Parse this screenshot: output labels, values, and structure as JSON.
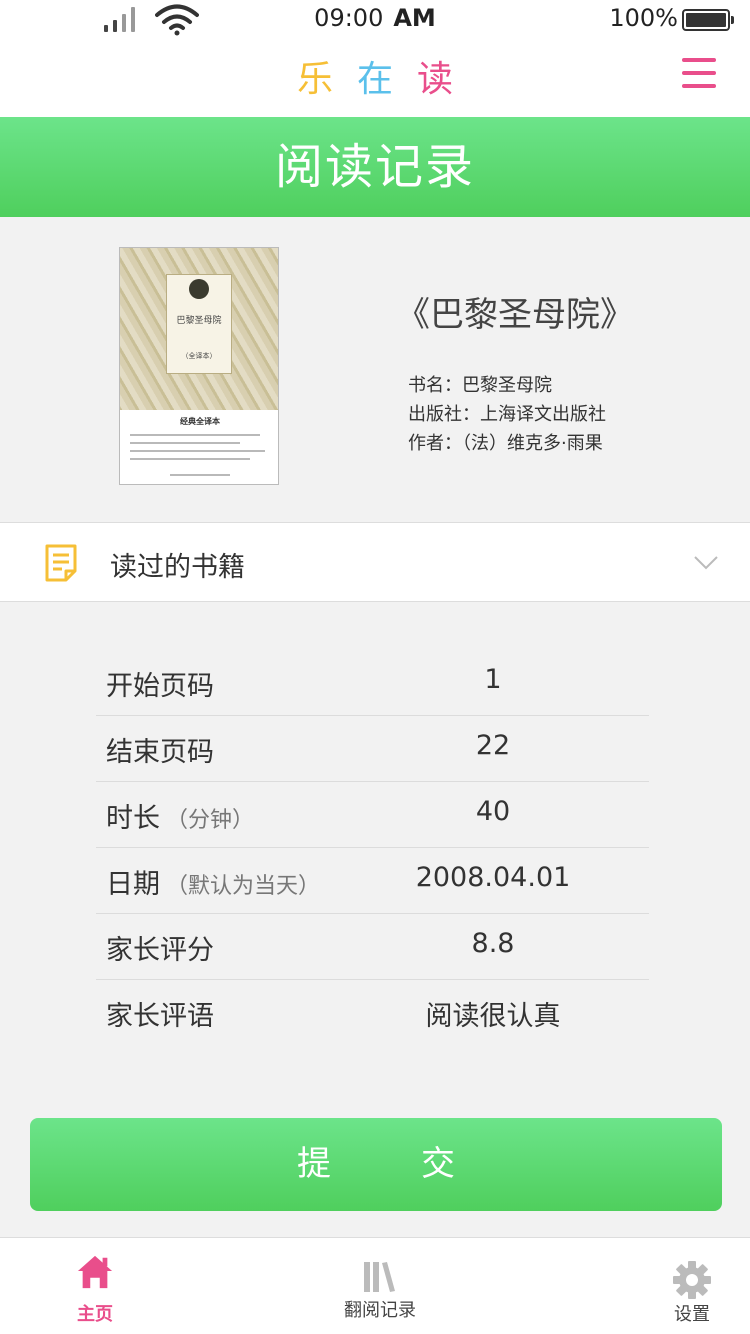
{
  "status_bar": {
    "time": "09:00",
    "ampm": "AM",
    "battery": "100%",
    "battery_level": 1.0
  },
  "header": {
    "logo_chars": [
      "乐",
      "在",
      "读"
    ]
  },
  "banner": {
    "title": "阅读记录"
  },
  "book": {
    "heading": "《巴黎圣母院》",
    "name_line": "书名：巴黎圣母院",
    "publisher_line": "出版社：上海译文出版社",
    "author_line": "作者：（法）维克多·雨果",
    "cover_title": "巴黎圣母院",
    "cover_edition": "（全译本）",
    "cover_tag": "经典全译本"
  },
  "section": {
    "label": "读过的书籍"
  },
  "form": {
    "rows": [
      {
        "label": "开始页码",
        "hint": "",
        "value": "1"
      },
      {
        "label": "结束页码",
        "hint": "",
        "value": "22"
      },
      {
        "label": "时长",
        "hint": "（分钟）",
        "value": "40"
      },
      {
        "label": "日期",
        "hint": "（默认为当天）",
        "value": "2008.04.01"
      },
      {
        "label": "家长评分",
        "hint": "",
        "value": "8.8"
      },
      {
        "label": "家长评语",
        "hint": "",
        "value": "阅读很认真"
      }
    ]
  },
  "submit": {
    "label": "提交"
  },
  "tabbar": {
    "items": [
      {
        "label": "主页",
        "icon": "home-icon",
        "active": true
      },
      {
        "label": "翻阅记录",
        "icon": "books-icon",
        "active": false
      },
      {
        "label": "设置",
        "icon": "gear-icon",
        "active": false
      }
    ]
  },
  "colors": {
    "green": "#4fcf5d",
    "pink": "#e94e8b",
    "yellow": "#f6bf36",
    "blue": "#5bc0eb"
  }
}
